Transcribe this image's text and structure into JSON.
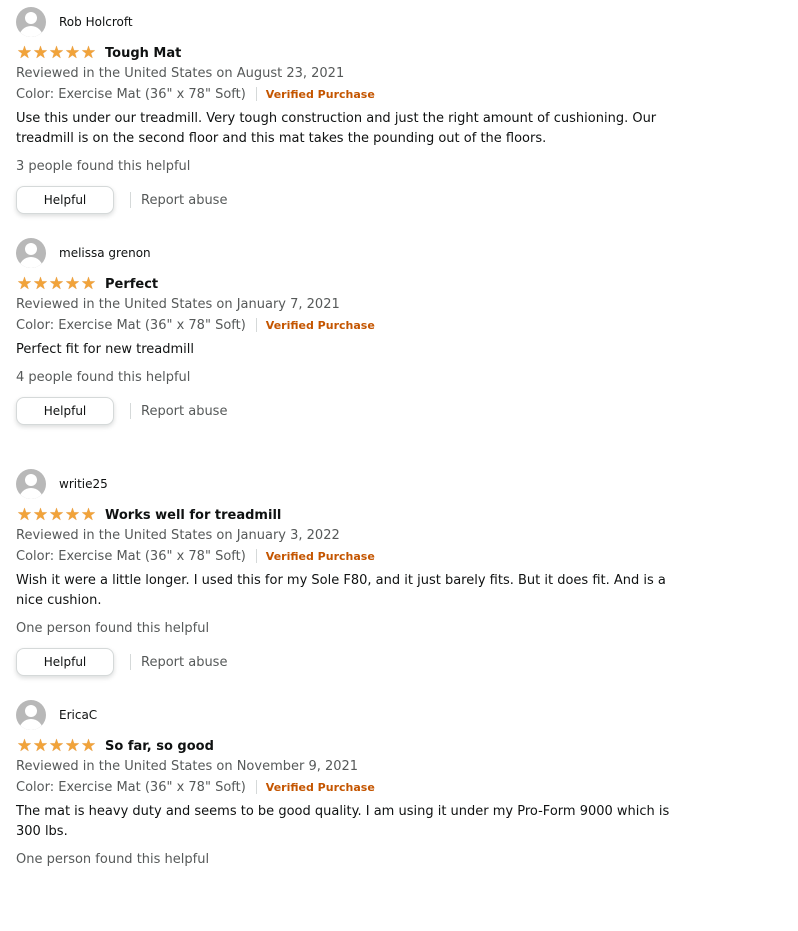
{
  "reviews": [
    {
      "profile_name": "Rob Holcroft",
      "rating": 5,
      "title": "Tough Mat",
      "date": "Reviewed in the United States on August 23, 2021",
      "variant": "Color: Exercise Mat (36\" x 78\" Soft)",
      "verified": "Verified Purchase",
      "body": "Use this under our treadmill. Very tough construction and just the right amount of cushioning. Our treadmill is on the second floor and this mat takes the pounding out of the floors.",
      "helpful_count": "3 people found this helpful",
      "helpful_label": "Helpful",
      "report_label": "Report abuse"
    },
    {
      "profile_name": "melissa grenon",
      "rating": 5,
      "title": "Perfect",
      "date": "Reviewed in the United States on January 7, 2021",
      "variant": "Color: Exercise Mat (36\" x 78\" Soft)",
      "verified": "Verified Purchase",
      "body": "Perfect fit for new treadmill",
      "helpful_count": "4 people found this helpful",
      "helpful_label": "Helpful",
      "report_label": "Report abuse"
    },
    {
      "profile_name": "writie25",
      "rating": 5,
      "title": "Works well for treadmill",
      "date": "Reviewed in the United States on January 3, 2022",
      "variant": "Color: Exercise Mat (36\" x 78\" Soft)",
      "verified": "Verified Purchase",
      "body": "Wish it were a little longer. I used this for my Sole F80, and it just barely fits. But it does fit. And is a nice cushion.",
      "helpful_count": "One person found this helpful",
      "helpful_label": "Helpful",
      "report_label": "Report abuse"
    },
    {
      "profile_name": "EricaC",
      "rating": 5,
      "title": "So far, so good",
      "date": "Reviewed in the United States on November 9, 2021",
      "variant": "Color: Exercise Mat (36\" x 78\" Soft)",
      "verified": "Verified Purchase",
      "body": "The mat is heavy duty and seems to be good quality. I am using it under my Pro-Form 9000 which is 300 lbs.",
      "helpful_count": "One person found this helpful"
    }
  ],
  "icons": {
    "avatar": "user-avatar-icon",
    "star": "star-icon"
  },
  "colors": {
    "star": "#f1a33a",
    "verified": "#c45500",
    "muted_text": "#565959",
    "text": "#0f1111"
  }
}
